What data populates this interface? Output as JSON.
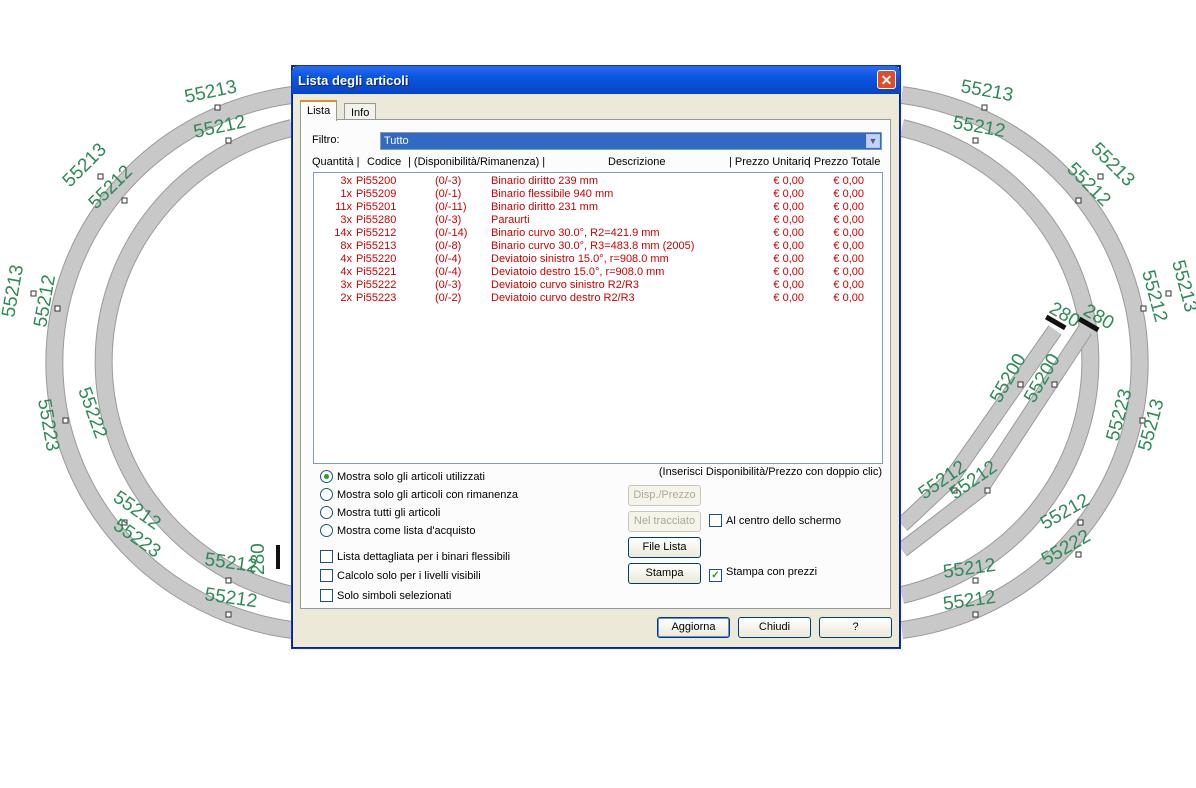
{
  "canvas_labels": {
    "left_top_outer": "55213",
    "left_top_inner": "55212",
    "left_upper_outer": "55213",
    "left_upper_inner": "55212",
    "left_mid_outer": "55213",
    "left_mid_inner": "55212",
    "left_low_a": "55222",
    "left_low_b": "55223",
    "left_low_c": "55212",
    "left_low_d": "55223",
    "left_bottom_a": "55212",
    "left_bottom_b": "55212",
    "left_stop": "280",
    "right_top_outer": "55213",
    "right_top_inner": "55212",
    "right_upper_outer": "55213",
    "right_upper_inner": "55212",
    "right_mid_outer": "55213",
    "right_mid_inner": "55212",
    "right_stop_a": "280",
    "right_stop_b": "280",
    "right_straight_a": "55200",
    "right_straight_b": "55200",
    "right_223": "55223",
    "right_213": "55213",
    "right_low_a": "55212",
    "right_low_b": "55212",
    "right_low_c": "55212",
    "right_low_d": "55222",
    "right_bottom_a": "55212",
    "right_bottom_b": "55212"
  },
  "dialog": {
    "title": "Lista degli articoli",
    "close_glyph": "✕",
    "tabs": [
      "Lista",
      "Info"
    ],
    "filter_label": "Filtro:",
    "filter_value": "Tutto",
    "columns": {
      "qty": "Quantità |",
      "code": "Codice",
      "disp": "| (Disponibilità/Rimanenza) |",
      "desc": "Descrizione",
      "unit_price": "| Prezzo Unitario",
      "total_price": "| Prezzo Totale"
    },
    "rows": [
      {
        "qty": "3x",
        "code": "Pi55200",
        "disp": "(0/-3)",
        "desc": "Binario diritto 239 mm",
        "unit": "€ 0,00",
        "total": "€ 0,00"
      },
      {
        "qty": "1x",
        "code": "Pi55209",
        "disp": "(0/-1)",
        "desc": "Binario flessibile 940 mm",
        "unit": "€ 0,00",
        "total": "€ 0,00"
      },
      {
        "qty": "11x",
        "code": "Pi55201",
        "disp": "(0/-11)",
        "desc": "Binario diritto 231 mm",
        "unit": "€ 0,00",
        "total": "€ 0,00"
      },
      {
        "qty": "3x",
        "code": "Pi55280",
        "disp": "(0/-3)",
        "desc": "Paraurti",
        "unit": "€ 0,00",
        "total": "€ 0,00"
      },
      {
        "qty": "14x",
        "code": "Pi55212",
        "disp": "(0/-14)",
        "desc": "Binario curvo 30.0°, R2=421.9 mm",
        "unit": "€ 0,00",
        "total": "€ 0,00"
      },
      {
        "qty": "8x",
        "code": "Pi55213",
        "disp": "(0/-8)",
        "desc": "Binario curvo 30.0°, R3=483.8 mm (2005)",
        "unit": "€ 0,00",
        "total": "€ 0,00"
      },
      {
        "qty": "4x",
        "code": "Pi55220",
        "disp": "(0/-4)",
        "desc": "Deviatoio sinistro 15.0°, r=908.0 mm",
        "unit": "€ 0,00",
        "total": "€ 0,00"
      },
      {
        "qty": "4x",
        "code": "Pi55221",
        "disp": "(0/-4)",
        "desc": "Deviatoio destro 15.0°, r=908.0 mm",
        "unit": "€ 0,00",
        "total": "€ 0,00"
      },
      {
        "qty": "3x",
        "code": "Pi55222",
        "disp": "(0/-3)",
        "desc": "Deviatoio curvo sinistro R2/R3",
        "unit": "€ 0,00",
        "total": "€ 0,00"
      },
      {
        "qty": "2x",
        "code": "Pi55223",
        "disp": "(0/-2)",
        "desc": "Deviatoio curvo destro R2/R3",
        "unit": "€ 0,00",
        "total": "€ 0,00"
      }
    ],
    "hint": "(Inserisci Disponibilità/Prezzo con doppio clic)",
    "radios": [
      "Mostra solo gli articoli utilizzati",
      "Mostra solo gli articoli con rimanenza",
      "Mostra tutti gli articoli",
      "Mostra come lista d'acquisto"
    ],
    "checks": [
      "Lista dettagliata per i binari flessibili",
      "Calcolo solo per i livelli visibili",
      "Solo simboli selezionati"
    ],
    "btn_disp": "Disp./Prezzo",
    "btn_nel": "Nel tracciato",
    "chk_center": "Al centro dello schermo",
    "btn_file": "File Lista",
    "btn_stampa": "Stampa",
    "chk_prices": "Stampa con prezzi",
    "btn_aggiorna": "Aggiorna",
    "btn_chiudi": "Chiudi",
    "btn_help": "?",
    "check_glyph": "✓"
  }
}
